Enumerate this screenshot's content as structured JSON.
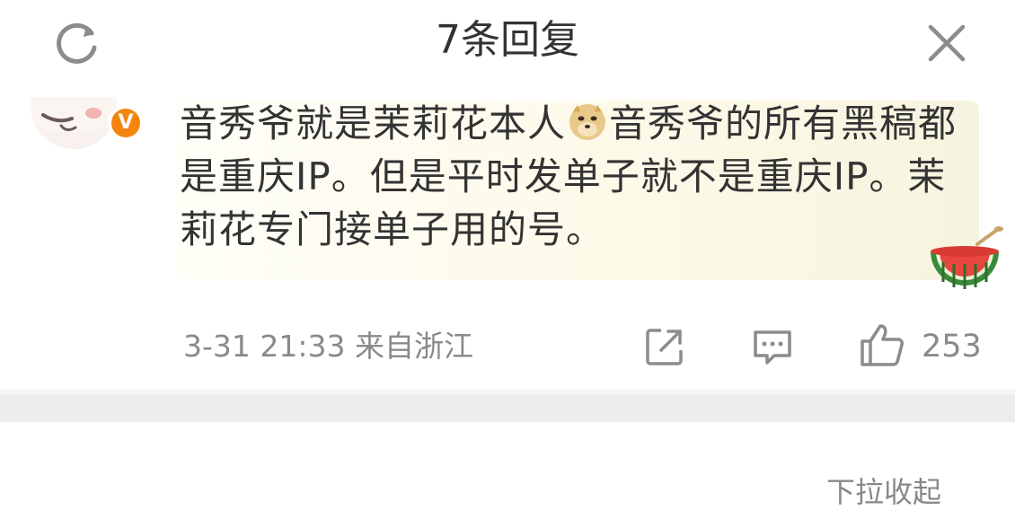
{
  "header": {
    "title": "7条回复",
    "refresh_icon": "refresh-icon",
    "close_icon": "close-icon"
  },
  "comment": {
    "badge_label": "V",
    "text_parts": [
      "音秀爷就是茉莉花本人",
      "音秀爷的所有黑稿都是重庆IP。但是平时发单子就不是重庆IP。茉莉花专门接单子用的号。"
    ],
    "inline_emoji": "doge-emoji-icon",
    "sticker": "watermelon-sticker-icon",
    "timestamp": "3-31 21:33",
    "location": "来自浙江",
    "like_count": "253"
  },
  "footer": {
    "partial_text": "下拉收起"
  },
  "colors": {
    "badge": "#f4840c",
    "meta_text": "#8a8a8a",
    "divider": "#ececec"
  }
}
